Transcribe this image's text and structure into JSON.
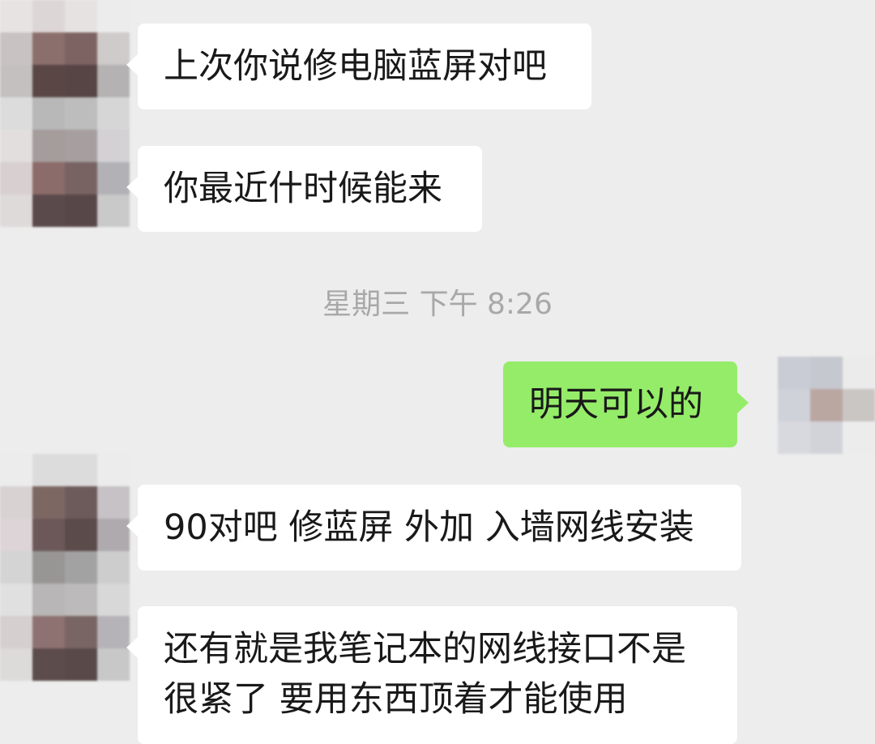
{
  "messages": [
    {
      "text": "上次你说修电脑蓝屏对吧"
    },
    {
      "text": "你最近什时候能来"
    },
    {
      "text": "明天可以的"
    },
    {
      "text": "90对吧 修蓝屏 外加 入墙网线安装"
    },
    {
      "lines": [
        "还有就是我笔记本的网线接口不是",
        "很紧了 要用东西顶着才能使用"
      ]
    }
  ],
  "timestamp": "星期三 下午 8:26",
  "colors": {
    "chat_background": "#ededed",
    "incoming_bubble": "#ffffff",
    "outgoing_bubble": "#95ec69",
    "timestamp_text": "#a8a8a8"
  },
  "icons": {
    "contact_avatar": "pixelated-avatar",
    "own_avatar": "pixelated-avatar"
  }
}
